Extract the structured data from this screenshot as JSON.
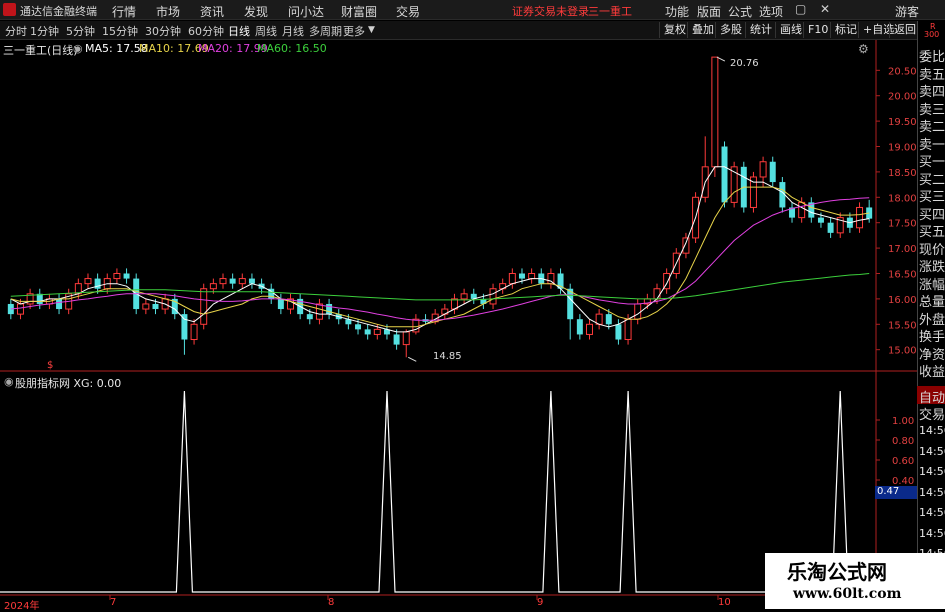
{
  "titlebar": {
    "app_name": "通达信金融终端",
    "menu": [
      "行情",
      "市场",
      "资讯",
      "发现",
      "问小达",
      "财富圈",
      "交易"
    ],
    "status": "证券交易未登录",
    "stock": "三一重工",
    "right_menu": [
      "功能",
      "版面",
      "公式",
      "选项"
    ],
    "guest": "游客"
  },
  "periodbar": {
    "periods": [
      "分时",
      "1分钟",
      "5分钟",
      "15分钟",
      "30分钟",
      "60分钟",
      "日线",
      "周线",
      "月线",
      "多周期",
      "更多"
    ],
    "active_period": "日线",
    "tools": [
      "复权",
      "叠加",
      "多股",
      "统计",
      "画线",
      "F10",
      "标记",
      "+自选",
      "返回"
    ]
  },
  "main_chart": {
    "stock_label": "三一重工(日线)",
    "ma_legend": [
      {
        "label": "MA5: 17.58",
        "color": "#ffffff"
      },
      {
        "label": "MA10: 17.69",
        "color": "#e8d44a"
      },
      {
        "label": "MA20: 17.99",
        "color": "#e040e0"
      },
      {
        "label": "MA60: 16.50",
        "color": "#3ccf3c"
      }
    ],
    "high_label": "20.76",
    "low_label": "14.85",
    "marker_s": "$"
  },
  "indicator": {
    "label": "股朋指标网 XG: 0.00",
    "current_value": "0.47"
  },
  "x_axis": [
    "2024年",
    "7",
    "8",
    "9",
    "10"
  ],
  "side_panel": {
    "top_labels": [
      "委比",
      "卖五",
      "卖四",
      "卖三",
      "卖二",
      "卖一",
      "买一",
      "买二",
      "买三",
      "买四",
      "买五",
      "现价",
      "涨跌",
      "涨幅",
      "总量",
      "外盘",
      "换手",
      "净资",
      "收益"
    ],
    "bottom_labels": [
      "自动",
      "交易"
    ],
    "times": [
      "14:56",
      "14:56",
      "14:56",
      "14:56",
      "14:56",
      "14:56",
      "14:56",
      "14:56",
      "14:56"
    ],
    "top_tag": "R",
    "top_num": "300"
  },
  "watermark": {
    "title": "乐淘公式网",
    "url": "www.60lt.com"
  },
  "chart_data": [
    {
      "type": "candlestick",
      "title": "三一重工(日线)",
      "ylim": [
        14.6,
        20.9
      ],
      "yticks": [
        "20.50",
        "20.00",
        "19.50",
        "19.00",
        "18.50",
        "18.00",
        "17.50",
        "17.00",
        "16.50",
        "16.00",
        "15.50",
        "15.00"
      ],
      "candles": [
        [
          15.9,
          15.7,
          16.0,
          15.6
        ],
        [
          15.7,
          15.9,
          16.0,
          15.6
        ],
        [
          15.9,
          16.1,
          16.2,
          15.8
        ],
        [
          16.1,
          15.9,
          16.2,
          15.8
        ],
        [
          15.9,
          16.0,
          16.1,
          15.8
        ],
        [
          16.0,
          15.8,
          16.1,
          15.7
        ],
        [
          15.8,
          16.1,
          16.2,
          15.7
        ],
        [
          16.1,
          16.3,
          16.4,
          16.0
        ],
        [
          16.3,
          16.4,
          16.5,
          16.2
        ],
        [
          16.4,
          16.2,
          16.5,
          16.1
        ],
        [
          16.2,
          16.4,
          16.5,
          16.1
        ],
        [
          16.4,
          16.5,
          16.6,
          16.3
        ],
        [
          16.5,
          16.4,
          16.6,
          16.3
        ],
        [
          16.4,
          15.8,
          16.5,
          15.7
        ],
        [
          15.8,
          15.9,
          16.0,
          15.7
        ],
        [
          15.9,
          15.8,
          16.0,
          15.7
        ],
        [
          15.8,
          16.0,
          16.1,
          15.7
        ],
        [
          16.0,
          15.7,
          16.1,
          15.6
        ],
        [
          15.7,
          15.2,
          15.8,
          14.9
        ],
        [
          15.2,
          15.5,
          15.6,
          15.1
        ],
        [
          15.5,
          16.2,
          16.3,
          15.4
        ],
        [
          16.2,
          16.3,
          16.4,
          16.1
        ],
        [
          16.3,
          16.4,
          16.5,
          16.2
        ],
        [
          16.4,
          16.3,
          16.5,
          16.2
        ],
        [
          16.3,
          16.4,
          16.5,
          16.2
        ],
        [
          16.4,
          16.3,
          16.5,
          16.2
        ],
        [
          16.3,
          16.2,
          16.4,
          16.1
        ],
        [
          16.2,
          16.0,
          16.3,
          15.9
        ],
        [
          16.0,
          15.8,
          16.1,
          15.7
        ],
        [
          15.8,
          16.0,
          16.1,
          15.7
        ],
        [
          16.0,
          15.7,
          16.1,
          15.6
        ],
        [
          15.7,
          15.6,
          15.8,
          15.5
        ],
        [
          15.6,
          15.9,
          16.0,
          15.5
        ],
        [
          15.9,
          15.7,
          16.0,
          15.6
        ],
        [
          15.7,
          15.6,
          15.8,
          15.5
        ],
        [
          15.6,
          15.5,
          15.7,
          15.4
        ],
        [
          15.5,
          15.4,
          15.6,
          15.3
        ],
        [
          15.4,
          15.3,
          15.5,
          15.2
        ],
        [
          15.3,
          15.4,
          15.5,
          15.2
        ],
        [
          15.4,
          15.3,
          15.5,
          15.2
        ],
        [
          15.3,
          15.1,
          15.4,
          15.0
        ],
        [
          15.1,
          15.35,
          15.4,
          14.85
        ],
        [
          15.35,
          15.6,
          15.7,
          15.3
        ],
        [
          15.6,
          15.55,
          15.7,
          15.5
        ],
        [
          15.55,
          15.7,
          15.8,
          15.5
        ],
        [
          15.7,
          15.8,
          15.9,
          15.6
        ],
        [
          15.8,
          16.0,
          16.1,
          15.7
        ],
        [
          16.0,
          16.1,
          16.2,
          15.9
        ],
        [
          16.1,
          16.0,
          16.2,
          15.9
        ],
        [
          16.0,
          15.9,
          16.1,
          15.8
        ],
        [
          15.9,
          16.2,
          16.3,
          15.8
        ],
        [
          16.2,
          16.3,
          16.4,
          16.1
        ],
        [
          16.3,
          16.5,
          16.6,
          16.2
        ],
        [
          16.5,
          16.4,
          16.6,
          16.3
        ],
        [
          16.4,
          16.5,
          16.6,
          16.3
        ],
        [
          16.5,
          16.3,
          16.6,
          16.2
        ],
        [
          16.3,
          16.5,
          16.6,
          16.2
        ],
        [
          16.5,
          16.2,
          16.6,
          16.1
        ],
        [
          16.2,
          15.6,
          16.3,
          15.2
        ],
        [
          15.6,
          15.3,
          15.7,
          15.2
        ],
        [
          15.3,
          15.5,
          15.6,
          15.2
        ],
        [
          15.5,
          15.7,
          15.8,
          15.4
        ],
        [
          15.7,
          15.5,
          15.8,
          15.4
        ],
        [
          15.5,
          15.2,
          15.6,
          15.1
        ],
        [
          15.2,
          15.6,
          15.7,
          15.1
        ],
        [
          15.6,
          15.9,
          16.0,
          15.5
        ],
        [
          15.9,
          16.0,
          16.1,
          15.8
        ],
        [
          16.0,
          16.2,
          16.3,
          15.9
        ],
        [
          16.2,
          16.5,
          16.6,
          16.1
        ],
        [
          16.5,
          16.9,
          17.0,
          16.4
        ],
        [
          16.9,
          17.2,
          17.3,
          16.8
        ],
        [
          17.2,
          18.0,
          18.1,
          17.1
        ],
        [
          18.0,
          18.6,
          19.2,
          17.9
        ],
        [
          18.6,
          20.76,
          20.76,
          18.4
        ],
        [
          19.0,
          17.9,
          19.1,
          17.8
        ],
        [
          17.9,
          18.6,
          18.7,
          17.8
        ],
        [
          18.6,
          17.8,
          18.7,
          17.7
        ],
        [
          17.8,
          18.4,
          18.5,
          17.7
        ],
        [
          18.4,
          18.7,
          18.8,
          18.2
        ],
        [
          18.7,
          18.3,
          18.8,
          18.2
        ],
        [
          18.3,
          17.8,
          18.4,
          17.7
        ],
        [
          17.8,
          17.6,
          17.9,
          17.5
        ],
        [
          17.6,
          17.9,
          18.0,
          17.5
        ],
        [
          17.9,
          17.6,
          18.0,
          17.5
        ],
        [
          17.6,
          17.5,
          17.7,
          17.4
        ],
        [
          17.5,
          17.3,
          17.6,
          17.2
        ],
        [
          17.3,
          17.6,
          17.7,
          17.2
        ],
        [
          17.6,
          17.4,
          17.7,
          17.3
        ],
        [
          17.4,
          17.8,
          17.9,
          17.3
        ],
        [
          17.8,
          17.58,
          17.95,
          17.5
        ]
      ],
      "series": [
        {
          "name": "MA5",
          "values": [
            16.0,
            15.9,
            15.95,
            15.95,
            16.0,
            16.0,
            16.05,
            16.1,
            16.2,
            16.25,
            16.3,
            16.3,
            16.25,
            16.1,
            16.0,
            15.95,
            15.9,
            15.8,
            15.6,
            15.55,
            15.7,
            15.9,
            16.0,
            16.1,
            16.2,
            16.3,
            16.25,
            16.15,
            16.0,
            15.95,
            15.85,
            15.75,
            15.7,
            15.7,
            15.65,
            15.6,
            15.55,
            15.5,
            15.45,
            15.4,
            15.35,
            15.35,
            15.4,
            15.5,
            15.6,
            15.7,
            15.8,
            15.9,
            16.0,
            16.05,
            16.1,
            16.2,
            16.3,
            16.35,
            16.4,
            16.4,
            16.35,
            16.2,
            16.0,
            15.8,
            15.6,
            15.5,
            15.45,
            15.5,
            15.6,
            15.7,
            15.85,
            16.0,
            16.3,
            16.7,
            17.1,
            17.6,
            18.3,
            18.6,
            18.6,
            18.5,
            18.4,
            18.3,
            18.3,
            18.2,
            18.1,
            17.9,
            17.8,
            17.7,
            17.65,
            17.6,
            17.55,
            17.5,
            17.55,
            17.58
          ]
        },
        {
          "name": "MA10",
          "values": [
            16.0,
            15.95,
            15.95,
            15.95,
            15.95,
            16.0,
            16.0,
            16.05,
            16.1,
            16.15,
            16.2,
            16.2,
            16.2,
            16.15,
            16.1,
            16.05,
            16.0,
            15.95,
            15.85,
            15.75,
            15.7,
            15.75,
            15.8,
            15.85,
            15.9,
            16.0,
            16.05,
            16.05,
            16.0,
            15.95,
            15.9,
            15.85,
            15.8,
            15.75,
            15.7,
            15.65,
            15.6,
            15.55,
            15.5,
            15.45,
            15.45,
            15.45,
            15.45,
            15.5,
            15.55,
            15.6,
            15.65,
            15.7,
            15.8,
            15.9,
            16.0,
            16.05,
            16.1,
            16.2,
            16.25,
            16.3,
            16.3,
            16.25,
            16.15,
            16.05,
            15.95,
            15.85,
            15.75,
            15.65,
            15.6,
            15.6,
            15.65,
            15.75,
            15.9,
            16.1,
            16.4,
            16.8,
            17.2,
            17.6,
            17.9,
            18.1,
            18.2,
            18.2,
            18.2,
            18.2,
            18.15,
            18.0,
            17.9,
            17.8,
            17.75,
            17.7,
            17.65,
            17.65,
            17.66,
            17.69
          ]
        },
        {
          "name": "MA20",
          "values": [
            15.8,
            15.82,
            15.85,
            15.88,
            15.9,
            15.93,
            15.95,
            15.98,
            16.0,
            16.03,
            16.05,
            16.08,
            16.1,
            16.1,
            16.1,
            16.1,
            16.08,
            16.06,
            16.03,
            16.0,
            15.98,
            15.96,
            15.95,
            15.95,
            15.96,
            15.98,
            16.0,
            16.0,
            16.0,
            15.98,
            15.95,
            15.92,
            15.88,
            15.85,
            15.82,
            15.8,
            15.77,
            15.74,
            15.7,
            15.67,
            15.63,
            15.6,
            15.58,
            15.58,
            15.58,
            15.6,
            15.62,
            15.65,
            15.68,
            15.72,
            15.76,
            15.8,
            15.85,
            15.9,
            15.95,
            16.0,
            16.05,
            16.08,
            16.08,
            16.06,
            16.02,
            15.98,
            15.95,
            15.92,
            15.9,
            15.9,
            15.92,
            15.95,
            16.0,
            16.1,
            16.2,
            16.35,
            16.55,
            16.75,
            16.95,
            17.15,
            17.3,
            17.45,
            17.55,
            17.65,
            17.72,
            17.78,
            17.82,
            17.86,
            17.9,
            17.93,
            17.95,
            17.96,
            17.98,
            17.99
          ]
        },
        {
          "name": "MA60",
          "values": [
            16.05,
            16.06,
            16.07,
            16.08,
            16.09,
            16.1,
            16.11,
            16.12,
            16.13,
            16.14,
            16.15,
            16.16,
            16.17,
            16.18,
            16.18,
            16.18,
            16.18,
            16.17,
            16.16,
            16.15,
            16.14,
            16.14,
            16.14,
            16.14,
            16.14,
            16.14,
            16.14,
            16.13,
            16.12,
            16.11,
            16.1,
            16.09,
            16.08,
            16.07,
            16.06,
            16.05,
            16.04,
            16.03,
            16.02,
            16.01,
            16.0,
            15.99,
            15.98,
            15.98,
            15.98,
            15.98,
            15.98,
            15.98,
            15.98,
            15.99,
            16.0,
            16.01,
            16.02,
            16.03,
            16.04,
            16.05,
            16.06,
            16.07,
            16.07,
            16.06,
            16.05,
            16.04,
            16.03,
            16.02,
            16.01,
            16.0,
            16.0,
            16.0,
            16.01,
            16.02,
            16.04,
            16.06,
            16.09,
            16.12,
            16.15,
            16.18,
            16.21,
            16.24,
            16.27,
            16.3,
            16.33,
            16.35,
            16.37,
            16.39,
            16.41,
            16.43,
            16.45,
            16.47,
            16.48,
            16.5
          ]
        }
      ]
    },
    {
      "type": "line",
      "title": "股朋指标网 XG",
      "ylim": [
        0,
        1.0
      ],
      "yticks": [
        "1.00",
        "0.80",
        "0.60",
        "0.40"
      ],
      "series": [
        {
          "name": "XG",
          "spikes_at_index": [
            18,
            39,
            56,
            64,
            86
          ],
          "values_at_spikes": [
            1,
            1,
            1,
            1,
            1
          ]
        }
      ]
    }
  ]
}
